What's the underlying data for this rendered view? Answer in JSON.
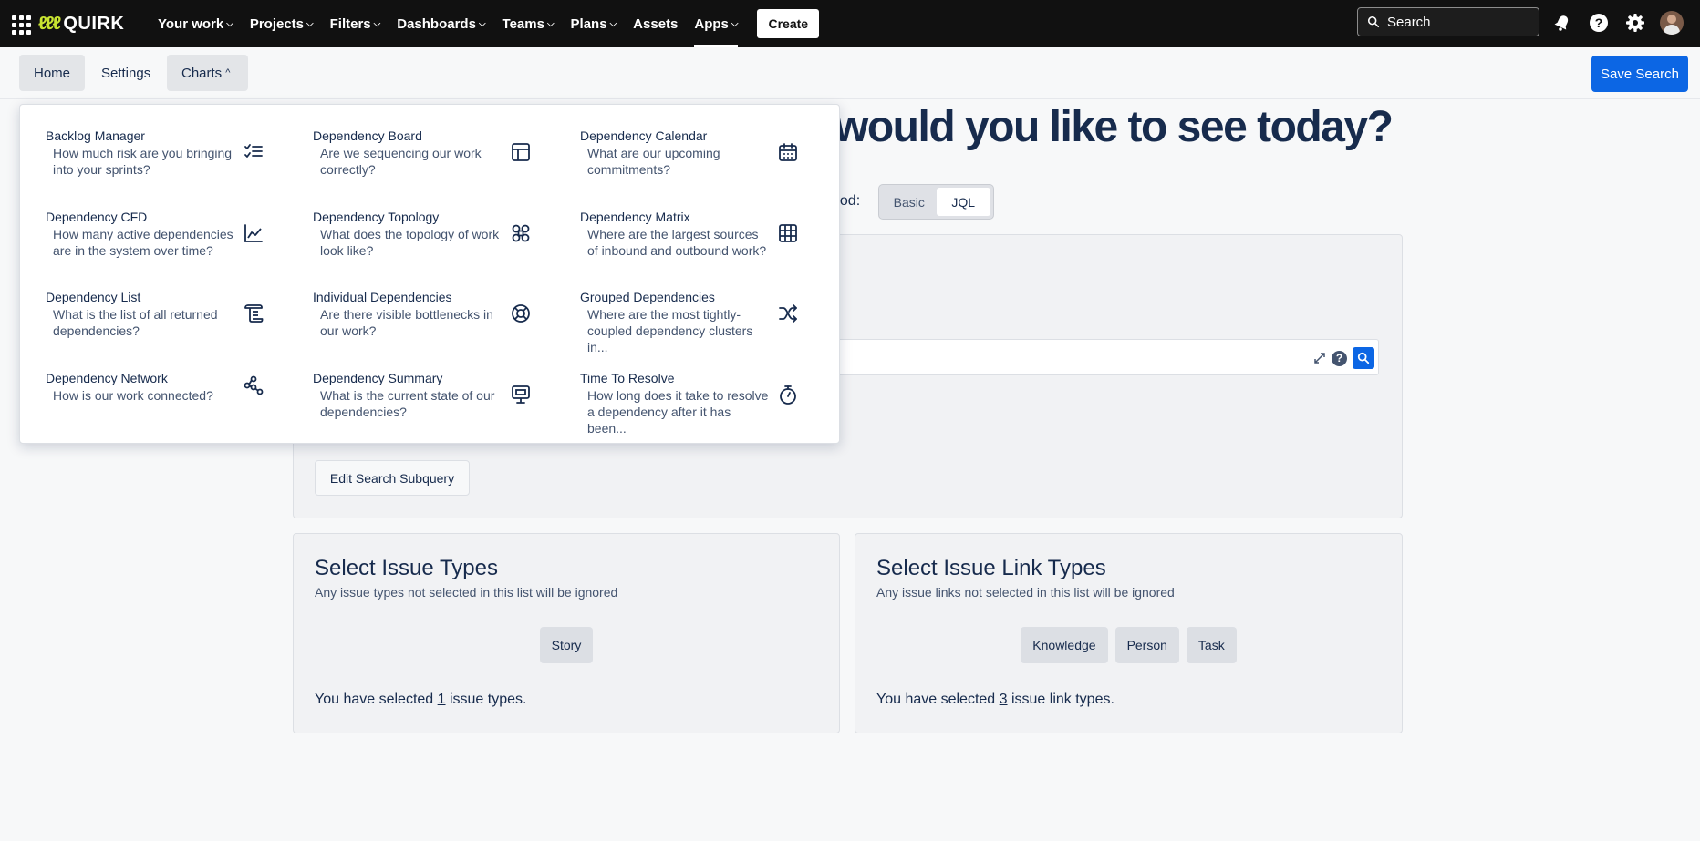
{
  "topnav": {
    "logo_text": "QUIRK",
    "items": [
      {
        "label": "Your work",
        "chev": "⌄"
      },
      {
        "label": "Projects",
        "chev": "⌄"
      },
      {
        "label": "Filters",
        "chev": "⌄"
      },
      {
        "label": "Dashboards",
        "chev": "⌄"
      },
      {
        "label": "Teams",
        "chev": "⌄"
      },
      {
        "label": "Plans",
        "chev": "⌄"
      },
      {
        "label": "Assets",
        "chev": ""
      },
      {
        "label": "Apps",
        "chev": "⌄"
      }
    ],
    "create_label": "Create",
    "search_placeholder": "Search",
    "icons": [
      "notifications-icon",
      "help-icon",
      "settings-icon",
      "avatar"
    ]
  },
  "subnav": {
    "tabs": [
      "Home",
      "Settings",
      "Charts"
    ],
    "charts_chevron": "^",
    "save_search_label": "Save Search"
  },
  "main": {
    "headline": "would you like to see today?",
    "method_label": "hod:",
    "method_options": [
      "Basic",
      "JQL"
    ],
    "method_selected": "JQL",
    "jql_help": "?",
    "edit_subquery_label": "Edit Search Subquery",
    "issue_types": {
      "title": "Select Issue Types",
      "subtitle": "Any issue types not selected in this list will be ignored",
      "chips": [
        "Story"
      ],
      "count_prefix": "You have selected ",
      "count": "1",
      "count_suffix": " issue types."
    },
    "link_types": {
      "title": "Select Issue Link Types",
      "subtitle": "Any issue links not selected in this list will be ignored",
      "chips": [
        "Knowledge",
        "Person",
        "Task"
      ],
      "count_prefix": "You have selected ",
      "count": "3",
      "count_suffix": " issue link types."
    }
  },
  "charts_menu": [
    {
      "title": "Backlog Manager",
      "desc": "How much risk are you bringing into your sprints?",
      "icon": "checklist-icon"
    },
    {
      "title": "Dependency Board",
      "desc": "Are we sequencing our work correctly?",
      "icon": "board-layout-icon"
    },
    {
      "title": "Dependency Calendar",
      "desc": "What are our upcoming commitments?",
      "icon": "calendar-icon"
    },
    {
      "title": "Dependency CFD",
      "desc": "How many active dependencies are in the system over time?",
      "icon": "area-chart-icon"
    },
    {
      "title": "Dependency Topology",
      "desc": "What does the topology of work look like?",
      "icon": "topology-icon"
    },
    {
      "title": "Dependency Matrix",
      "desc": "Where are the largest sources of inbound and outbound work?",
      "icon": "grid-icon"
    },
    {
      "title": "Dependency List",
      "desc": "What is the list of all returned dependencies?",
      "icon": "scroll-list-icon"
    },
    {
      "title": "Individual Dependencies",
      "desc": "Are there visible bottlenecks in our work?",
      "icon": "lifebuoy-icon"
    },
    {
      "title": "Grouped Dependencies",
      "desc": "Where are the most tightly-coupled dependency clusters in...",
      "icon": "shuffle-icon"
    },
    {
      "title": "Dependency Network",
      "desc": "How is our work connected?",
      "icon": "network-icon"
    },
    {
      "title": "Dependency Summary",
      "desc": "What is the current state of our dependencies?",
      "icon": "monitor-icon"
    },
    {
      "title": "Time To Resolve",
      "desc": "How long does it take to resolve a dependency after it has been...",
      "icon": "stopwatch-icon"
    }
  ]
}
